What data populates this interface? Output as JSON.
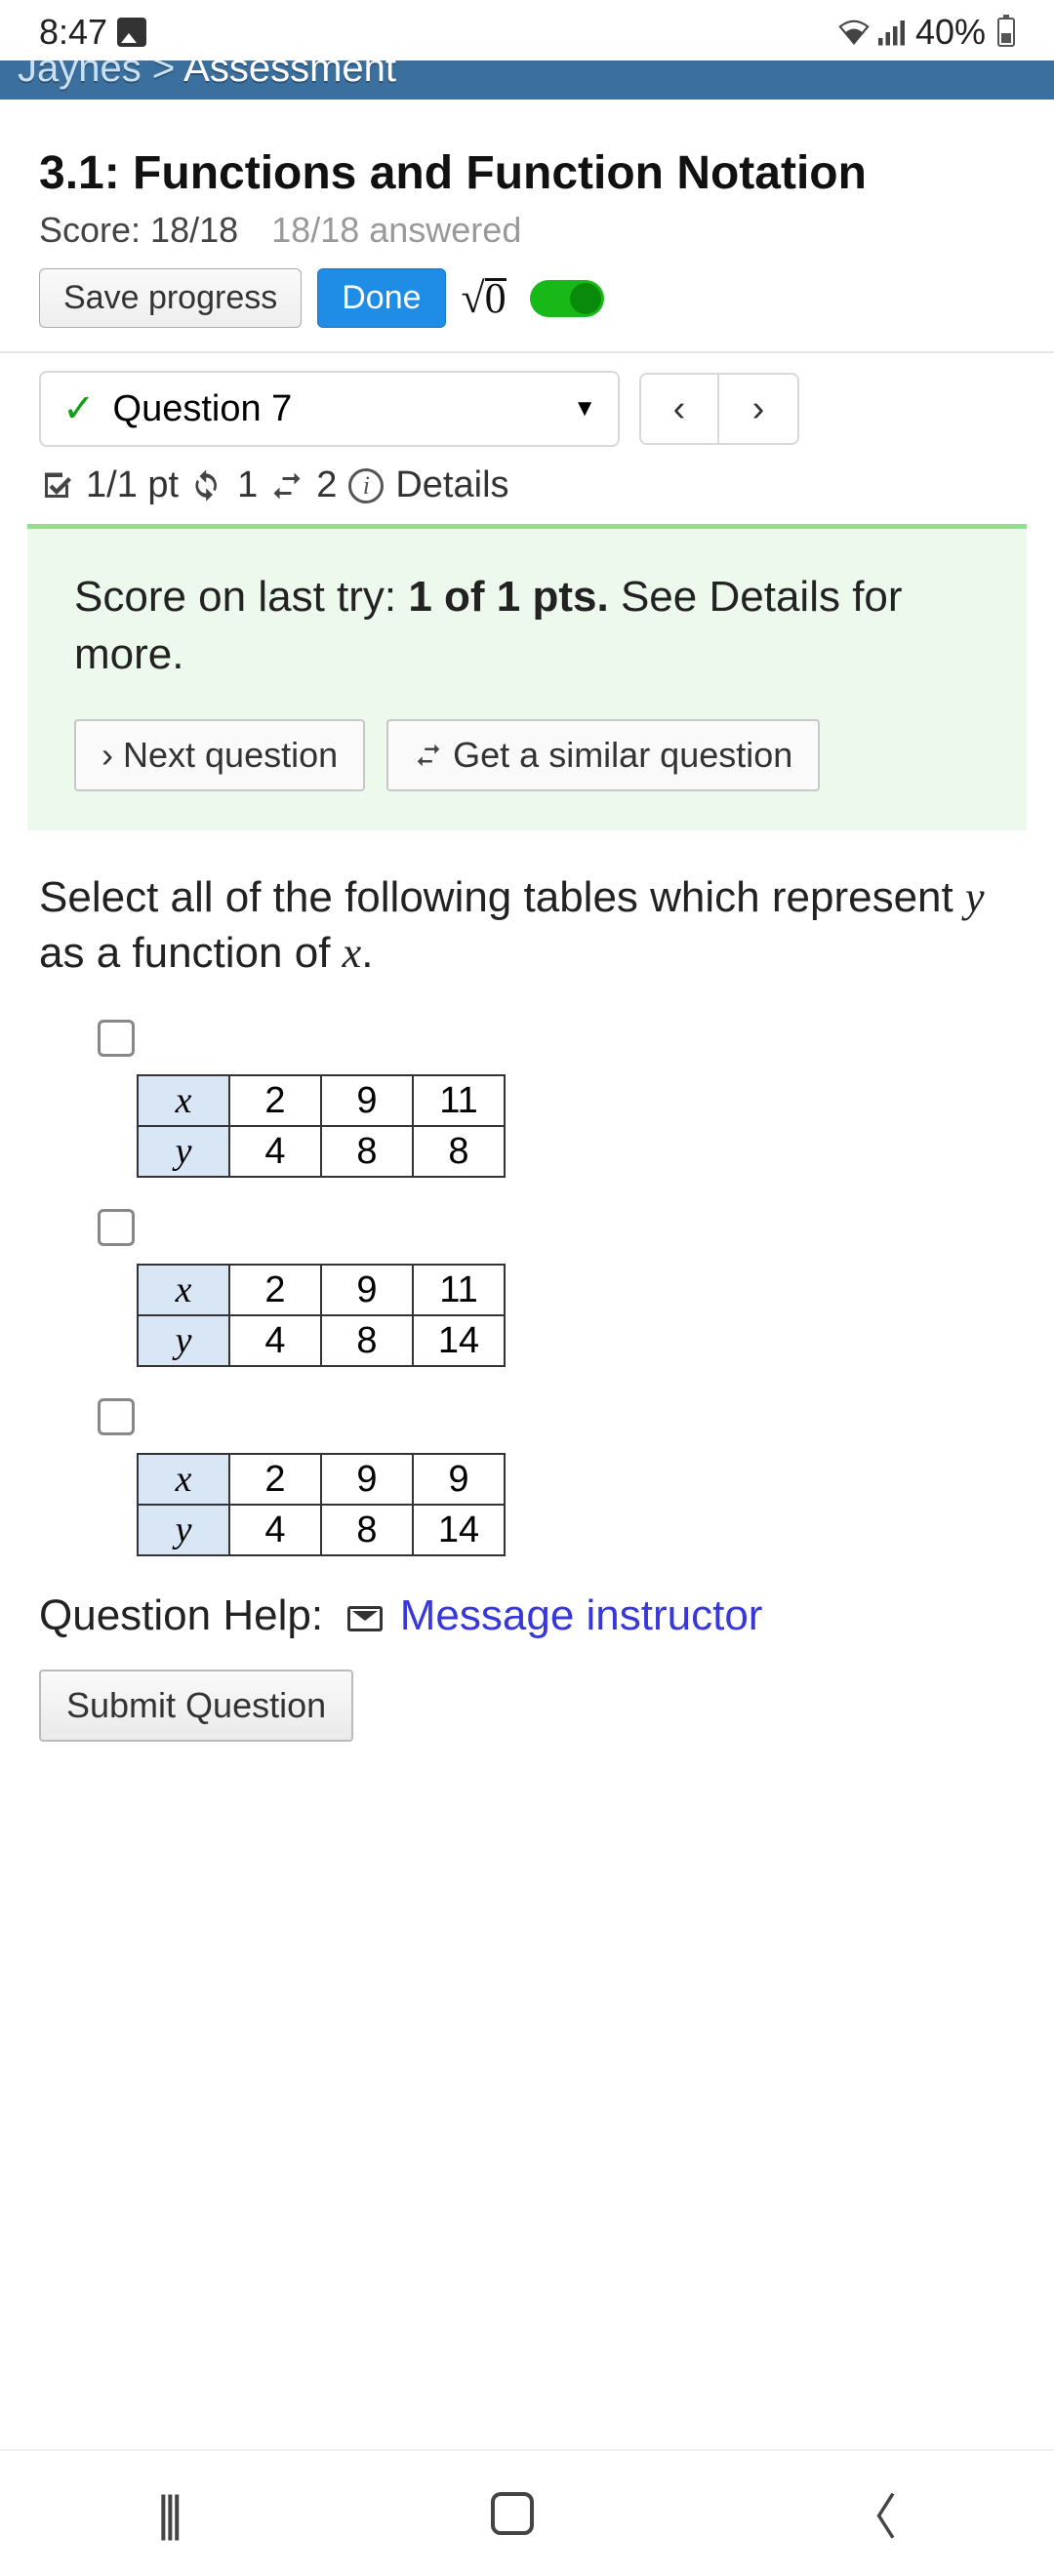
{
  "status": {
    "time": "8:47",
    "battery": "40%"
  },
  "breadcrumb": {
    "a": "Jaynes",
    "sep": ">",
    "b": "Assessment"
  },
  "page": {
    "title": "3.1: Functions and Function Notation",
    "score_label": "Score: 18/18",
    "answered": "18/18 answered",
    "save": "Save progress",
    "done": "Done",
    "sqrt_content": "0"
  },
  "question_nav": {
    "label": "Question 7"
  },
  "pts": {
    "frac": "1/1 pt",
    "retry": "1",
    "regen": "2",
    "details": "Details"
  },
  "scorecard": {
    "prefix": "Score on last try: ",
    "bold": "1 of 1 pts.",
    "suffix": " See Details for more.",
    "next": "Next question",
    "similar": "Get a similar question"
  },
  "prompt": {
    "a": "Select all of the following tables which represent ",
    "y": "y",
    "b": " as a function of ",
    "x": "x",
    "c": "."
  },
  "tables": [
    {
      "xlabel": "x",
      "ylabel": "y",
      "x": [
        "2",
        "9",
        "11"
      ],
      "y": [
        "4",
        "8",
        "8"
      ]
    },
    {
      "xlabel": "x",
      "ylabel": "y",
      "x": [
        "2",
        "9",
        "11"
      ],
      "y": [
        "4",
        "8",
        "14"
      ]
    },
    {
      "xlabel": "x",
      "ylabel": "y",
      "x": [
        "2",
        "9",
        "9"
      ],
      "y": [
        "4",
        "8",
        "14"
      ]
    }
  ],
  "help": {
    "label": "Question Help:",
    "link": "Message instructor"
  },
  "submit": "Submit Question"
}
